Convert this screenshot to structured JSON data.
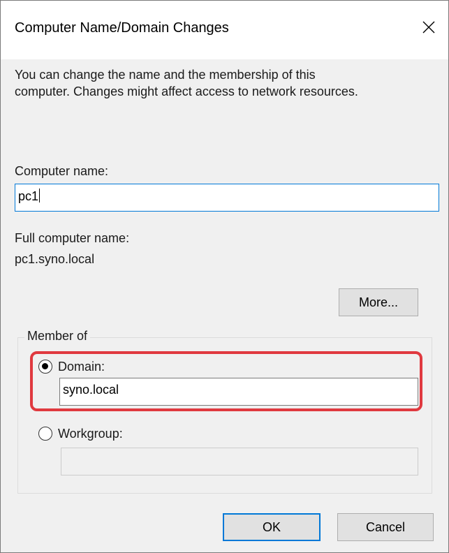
{
  "window": {
    "title": "Computer Name/Domain Changes",
    "close_glyph": "✕"
  },
  "intro_text_line1": "You can change the name and the membership of this",
  "intro_text_line2": "computer. Changes might affect access to network resources.",
  "computer_name": {
    "label": "Computer name:",
    "value": "pc1"
  },
  "full_computer_name": {
    "label": "Full computer name:",
    "value": "pc1.syno.local"
  },
  "buttons": {
    "more": "More...",
    "ok": "OK",
    "cancel": "Cancel"
  },
  "member_of": {
    "label": "Member of",
    "domain": {
      "label": "Domain:",
      "value": "syno.local",
      "selected": true
    },
    "workgroup": {
      "label": "Workgroup:",
      "value": "",
      "selected": false
    }
  },
  "colors": {
    "focus_border": "#0078d7",
    "highlight_annotation": "#e0393f",
    "dialog_bg": "#f0f0f0"
  }
}
